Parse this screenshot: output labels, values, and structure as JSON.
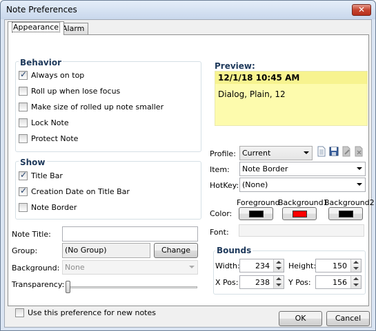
{
  "window": {
    "title": "Note Preferences",
    "close_glyph": "✕"
  },
  "tabs": [
    {
      "label": "Appearance"
    },
    {
      "label": "Alarm"
    }
  ],
  "behavior": {
    "title": "Behavior",
    "items": [
      {
        "label": "Always on top",
        "checked": true
      },
      {
        "label": "Roll up when lose focus",
        "checked": false
      },
      {
        "label": "Make size of rolled up note smaller",
        "checked": false
      },
      {
        "label": "Lock Note",
        "checked": false
      },
      {
        "label": "Protect Note",
        "checked": false
      }
    ]
  },
  "show": {
    "title": "Show",
    "items": [
      {
        "label": "Title Bar",
        "checked": true
      },
      {
        "label": "Creation Date on Title Bar",
        "checked": true
      },
      {
        "label": "Note Border",
        "checked": false
      }
    ]
  },
  "form": {
    "note_title_label": "Note Title:",
    "note_title_value": "",
    "group_label": "Group:",
    "group_value": "(No Group)",
    "change_button": "Change",
    "background_label": "Background:",
    "background_value": "None",
    "transparency_label": "Transparency:",
    "transparency_value": 0
  },
  "use_pref": {
    "label": "Use this preference for new notes",
    "checked": false
  },
  "preview": {
    "title": "Preview:",
    "date": "12/1/18 10:45 AM",
    "font": "Dialog, Plain, 12",
    "bg_color": "#fdfbad",
    "header_color": "#f7f38f"
  },
  "profile": {
    "label": "Profile:",
    "value": "Current",
    "icons": [
      "new-profile-icon",
      "save-profile-icon",
      "rename-profile-icon",
      "delete-profile-icon"
    ]
  },
  "item": {
    "label": "Item:",
    "value": "Note Border"
  },
  "hotkey": {
    "label": "HotKey:",
    "value": "(None)"
  },
  "colors": {
    "label": "Color:",
    "headers": [
      "Foreground",
      "Background1",
      "Background2"
    ],
    "swatches": [
      "#000000",
      "#ff0000",
      "#000000"
    ]
  },
  "font": {
    "label": "Font:",
    "value": ""
  },
  "bounds": {
    "title": "Bounds",
    "width_label": "Width:",
    "width_value": "234",
    "height_label": "Height:",
    "height_value": "150",
    "xpos_label": "X Pos:",
    "xpos_value": "238",
    "ypos_label": "Y Pos:",
    "ypos_value": "156"
  },
  "buttons": {
    "ok": "OK",
    "cancel": "Cancel"
  }
}
